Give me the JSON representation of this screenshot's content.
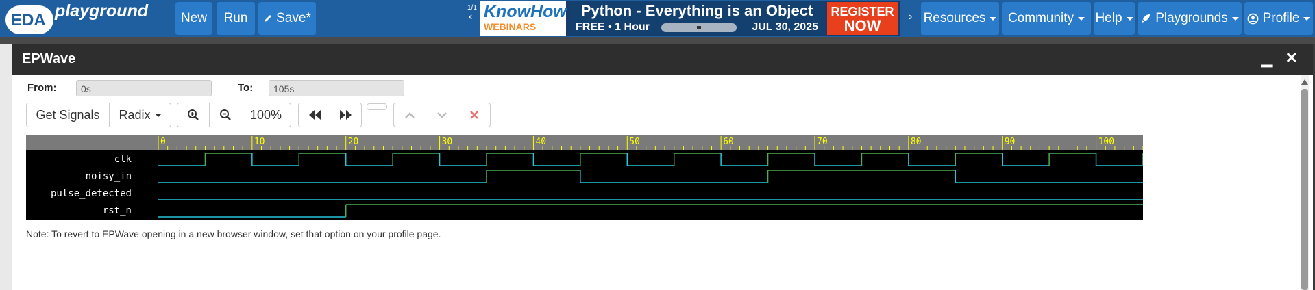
{
  "navbar": {
    "logo_eda": "EDA",
    "logo_playground": "playground",
    "buttons": {
      "new": "New",
      "run": "Run",
      "save": "Save*"
    },
    "banner": {
      "brand": "KnowHow",
      "brand_sub": "WEBINARS",
      "title": "Python - Everything is an Object",
      "free": "FREE • 1 Hour",
      "date": "JUL 30, 2025",
      "register_1": "REGISTER",
      "register_2": "NOW",
      "pager": "1/1"
    },
    "menus": {
      "resources": "Resources",
      "community": "Community",
      "help": "Help",
      "playgrounds": "Playgrounds",
      "profile": "Profile"
    }
  },
  "dialog": {
    "title": "EPWave",
    "from_label": "From:",
    "from_value": "0s",
    "to_label": "To:",
    "to_value": "105s",
    "toolbar": {
      "get_signals": "Get Signals",
      "radix": "Radix",
      "zoom_level": "100%"
    },
    "note": "Note: To revert to EPWave opening in a new browser window, set that option on your profile page."
  },
  "waveform": {
    "time_range": [
      0,
      105
    ],
    "ruler_ticks": [
      "0",
      "10",
      "20",
      "30",
      "40",
      "50",
      "60",
      "70",
      "80",
      "90",
      "100"
    ],
    "signals": [
      {
        "name": "clk",
        "transitions": [
          [
            0,
            0
          ],
          [
            5,
            1
          ],
          [
            10,
            0
          ],
          [
            15,
            1
          ],
          [
            20,
            0
          ],
          [
            25,
            1
          ],
          [
            30,
            0
          ],
          [
            35,
            1
          ],
          [
            40,
            0
          ],
          [
            45,
            1
          ],
          [
            50,
            0
          ],
          [
            55,
            1
          ],
          [
            60,
            0
          ],
          [
            65,
            1
          ],
          [
            70,
            0
          ],
          [
            75,
            1
          ],
          [
            80,
            0
          ],
          [
            85,
            1
          ],
          [
            90,
            0
          ],
          [
            95,
            1
          ],
          [
            100,
            0
          ],
          [
            105,
            1
          ]
        ]
      },
      {
        "name": "noisy_in",
        "transitions": [
          [
            0,
            0
          ],
          [
            35,
            1
          ],
          [
            45,
            0
          ],
          [
            65,
            1
          ],
          [
            85,
            0
          ]
        ]
      },
      {
        "name": "pulse_detected",
        "transitions": [
          [
            0,
            0
          ]
        ]
      },
      {
        "name": "rst_n",
        "transitions": [
          [
            0,
            0
          ],
          [
            20,
            1
          ]
        ]
      }
    ],
    "colors": {
      "low": "#26c6da",
      "high": "#4caf50",
      "ruler_text": "#ffff00"
    }
  }
}
